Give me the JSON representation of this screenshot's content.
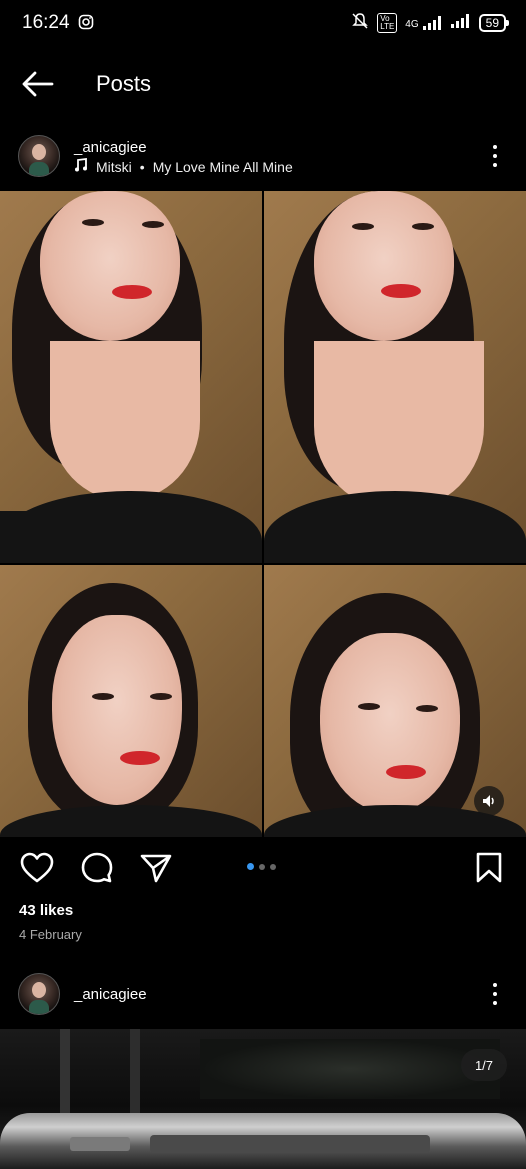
{
  "status_bar": {
    "time": "16:24",
    "network": "4G",
    "battery": "59"
  },
  "header": {
    "title": "Posts"
  },
  "post1": {
    "username": "_anicagiee",
    "music_artist": "Mitski",
    "separator": "•",
    "music_title": "My Love Mine All Mine",
    "likes": "43 likes",
    "date": "4 February"
  },
  "post2": {
    "username": "_anicagiee",
    "counter": "1/7"
  },
  "colors": {
    "background": "#000000",
    "carousel_active": "#3897f0",
    "lipstick": "#d0262b"
  }
}
